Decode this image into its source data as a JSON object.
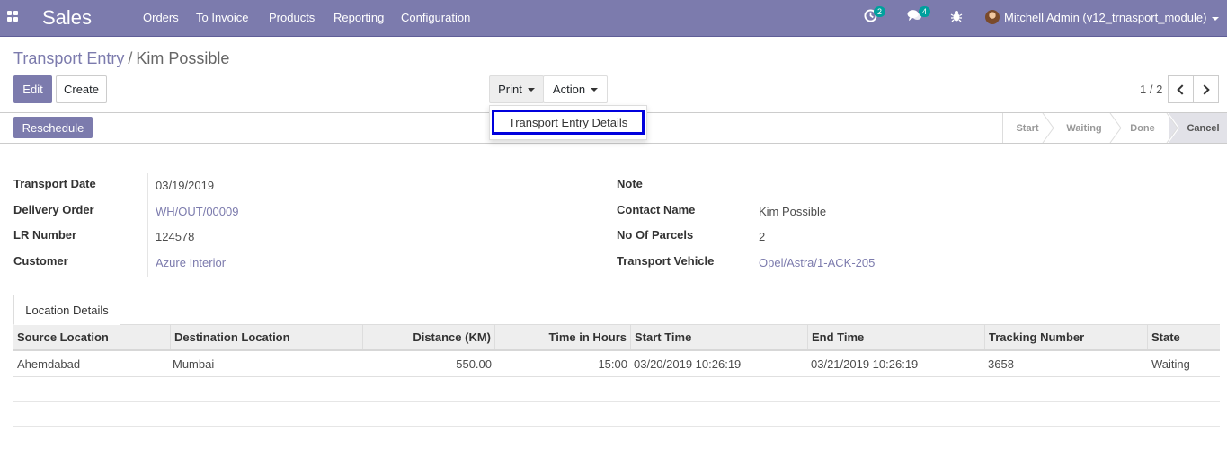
{
  "navbar": {
    "app_name": "Sales",
    "menu": [
      "Orders",
      "To Invoice",
      "Products",
      "Reporting",
      "Configuration"
    ],
    "activity_count": "2",
    "messages_count": "4",
    "user": "Mitchell Admin (v12_trnasport_module)",
    "accent_color": "#7c7bad"
  },
  "breadcrumb": {
    "parent": "Transport Entry",
    "separator": "/",
    "current": "Kim Possible"
  },
  "buttons": {
    "edit": "Edit",
    "create": "Create",
    "print": "Print",
    "action": "Action"
  },
  "print_menu": {
    "items": [
      "Transport Entry Details"
    ]
  },
  "pager": {
    "value": "1 / 2"
  },
  "status_bar": {
    "reschedule": "Reschedule",
    "stages": [
      "Start",
      "Waiting",
      "Done",
      "Cancel"
    ],
    "active_stage": "Cancel"
  },
  "form": {
    "left": [
      {
        "label": "Transport Date",
        "value": "03/19/2019"
      },
      {
        "label": "Delivery Order",
        "value": "WH/OUT/00009"
      },
      {
        "label": "LR Number",
        "value": "124578"
      },
      {
        "label": "Customer",
        "value": "Azure Interior"
      }
    ],
    "right": [
      {
        "label": "Note",
        "value": ""
      },
      {
        "label": "Contact Name",
        "value": "Kim Possible"
      },
      {
        "label": "No Of Parcels",
        "value": "2"
      },
      {
        "label": "Transport Vehicle",
        "value": "Opel/Astra/1-ACK-205"
      }
    ]
  },
  "notebook": {
    "tab": "Location Details"
  },
  "table": {
    "columns": [
      "Source Location",
      "Destination Location",
      "Distance (KM)",
      "Time in Hours",
      "Start Time",
      "End Time",
      "Tracking Number",
      "State"
    ],
    "rows": [
      [
        "Ahemdabad",
        "Mumbai",
        "550.00",
        "15:00",
        "03/20/2019 10:26:19",
        "03/21/2019 10:26:19",
        "3658",
        "Waiting"
      ]
    ]
  }
}
